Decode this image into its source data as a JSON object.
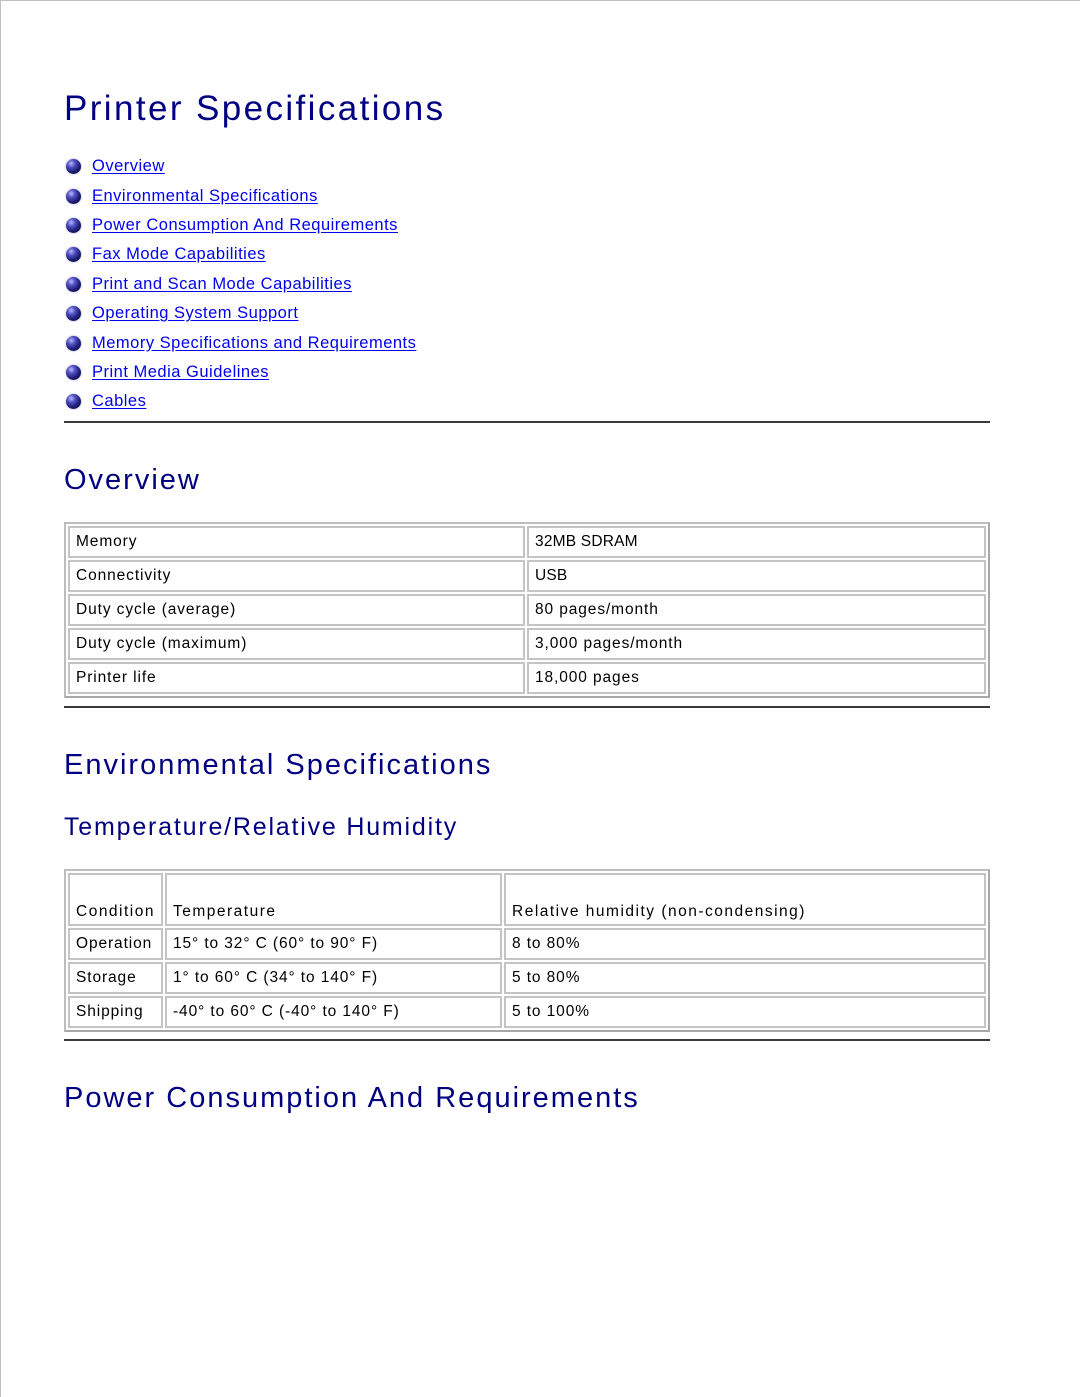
{
  "page_title": "Printer Specifications",
  "toc": [
    {
      "label": "Overview",
      "icon": "bullet-sphere-icon"
    },
    {
      "label": "Environmental Specifications",
      "icon": "bullet-sphere-icon"
    },
    {
      "label": "Power Consumption And Requirements",
      "icon": "bullet-sphere-icon"
    },
    {
      "label": "Fax Mode Capabilities",
      "icon": "bullet-sphere-icon"
    },
    {
      "label": "Print and Scan Mode Capabilities",
      "icon": "bullet-sphere-icon"
    },
    {
      "label": "Operating System Support",
      "icon": "bullet-sphere-icon"
    },
    {
      "label": "Memory Specifications and Requirements",
      "icon": "bullet-sphere-icon"
    },
    {
      "label": "Print Media Guidelines",
      "icon": "bullet-sphere-icon"
    },
    {
      "label": "Cables",
      "icon": "bullet-sphere-icon"
    }
  ],
  "overview": {
    "heading": "Overview",
    "rows": [
      {
        "label": "Memory",
        "value": "32MB SDRAM"
      },
      {
        "label": "Connectivity",
        "value": "USB"
      },
      {
        "label": "Duty cycle (average)",
        "value": "80 pages/month"
      },
      {
        "label": "Duty cycle (maximum)",
        "value": "3,000 pages/month"
      },
      {
        "label": "Printer life",
        "value": "18,000 pages"
      }
    ]
  },
  "environmental": {
    "heading": "Environmental Specifications",
    "subheading": "Temperature/Relative Humidity",
    "columns": [
      "Condition",
      "Temperature",
      "Relative humidity (non-condensing)"
    ],
    "rows": [
      [
        "Operation",
        "15° to 32° C (60° to 90° F)",
        "8 to 80%"
      ],
      [
        "Storage",
        "1° to 60° C (34° to 140° F)",
        "5 to 80%"
      ],
      [
        "Shipping",
        "-40° to 60° C (-40° to 140° F)",
        "5 to 100%"
      ]
    ]
  },
  "power": {
    "heading": "Power Consumption And Requirements"
  },
  "colors": {
    "heading": "#000080",
    "link": "#0000ee",
    "rule": "#3a3a3a",
    "table_border": "#c4c4c4"
  }
}
